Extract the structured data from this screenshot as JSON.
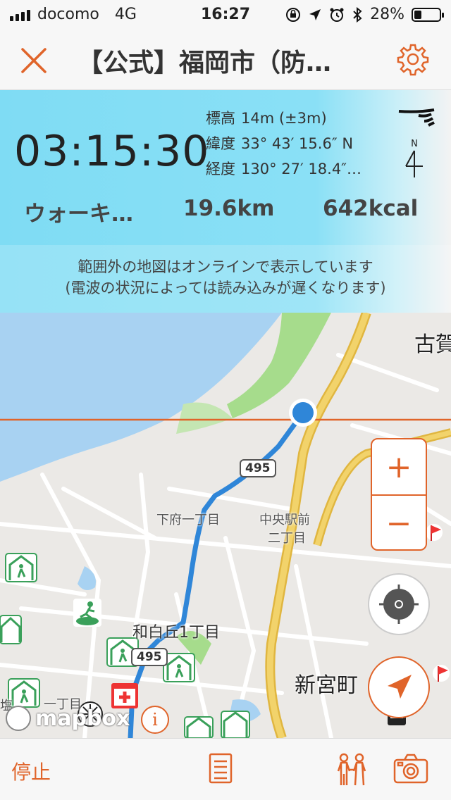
{
  "status_bar": {
    "carrier": "docomo",
    "network": "4G",
    "time": "16:27",
    "battery_percent": "28%",
    "battery_level": 0.28,
    "icons": [
      "orientation-lock-icon",
      "location-arrow-icon",
      "alarm-icon",
      "bluetooth-icon"
    ]
  },
  "nav": {
    "title": "【公式】福岡市（防…",
    "close_icon": "close-icon",
    "settings_icon": "gear-icon"
  },
  "info": {
    "elapsed_time": "03:15:30",
    "altitude_label": "標高",
    "altitude_value": "14m (±3m)",
    "latitude_label": "緯度",
    "latitude_value": "33° 43′ 15.6″ N",
    "longitude_label": "経度",
    "longitude_value": "130° 27′ 18.4″…",
    "compass_letter": "N",
    "activity": "ウォーキ…",
    "distance": "19.6km",
    "calories": "642kcal",
    "notice_line1": "範囲外の地図はオンラインで表示しています",
    "notice_line2": "(電波の状況によっては読み込みが遅くなります)"
  },
  "map": {
    "labels": {
      "koga": "古賀",
      "shimofu": "下府一丁目",
      "chuo_ekimae": "中央駅前",
      "nichome": "二丁目",
      "wajirogaoka": "和白丘1丁目",
      "shingu": "新宮町",
      "shio": "塩",
      "itchome": "一丁目"
    },
    "route_shield_top": "495",
    "route_shield_bottom": "495",
    "zoom_in": "+",
    "zoom_out": "−",
    "mapbox": "mapbox",
    "info_button": "i",
    "colors": {
      "accent": "#e0642a",
      "route": "#2f86d8",
      "water": "#a8d2f2",
      "park": "#a6dc8c",
      "major_road": "#f2d36b"
    }
  },
  "toolbar": {
    "stop_label": "停止",
    "icons": [
      "list-icon",
      "people-icon",
      "camera-icon"
    ]
  }
}
